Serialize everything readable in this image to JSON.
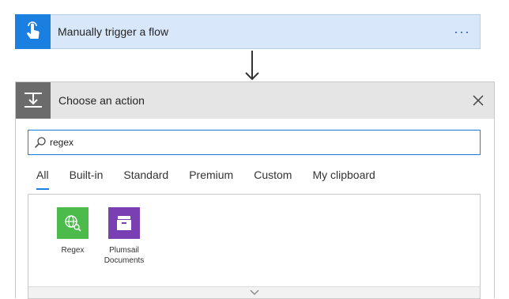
{
  "trigger": {
    "title": "Manually trigger a flow",
    "icon": "hand-touch-icon",
    "menu_label": "···",
    "color": "#1a7fe0"
  },
  "action": {
    "title": "Choose an action",
    "icon": "action-step-icon",
    "close_icon": "close-icon"
  },
  "search": {
    "value": "regex",
    "icon": "search-icon"
  },
  "tabs": [
    {
      "label": "All",
      "active": true
    },
    {
      "label": "Built-in",
      "active": false
    },
    {
      "label": "Standard",
      "active": false
    },
    {
      "label": "Premium",
      "active": false
    },
    {
      "label": "Custom",
      "active": false
    },
    {
      "label": "My clipboard",
      "active": false
    }
  ],
  "connectors": [
    {
      "label": "Regex",
      "icon": "globe-search-icon",
      "color": "#4cbb4c"
    },
    {
      "label": "Plumsail Documents",
      "icon": "archive-box-icon",
      "color": "#7a3fb3"
    }
  ],
  "footer": {
    "icon": "chevron-down-icon"
  }
}
